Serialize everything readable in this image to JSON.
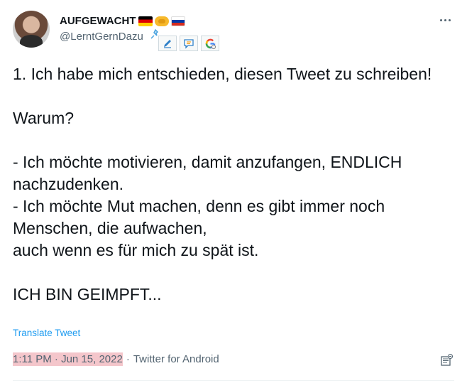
{
  "header": {
    "display_name": "AUFGEWACHT",
    "handle": "@LerntGernDazu"
  },
  "tweet": {
    "text": "1. Ich habe mich entschieden, diesen Tweet zu schreiben!\n\nWarum?\n\n- Ich möchte motivieren, damit anzufangen, ENDLICH nachzudenken.\n- Ich möchte Mut machen, denn es gibt immer noch Menschen, die aufwachen,\nauch wenn es für mich zu spät ist.\n\nICH BIN GEIMPFT...",
    "translate_label": "Translate Tweet"
  },
  "meta": {
    "time": "1:11 PM · Jun 15, 2022",
    "separator": "·",
    "source": "Twitter for Android"
  },
  "icons": {
    "flags": [
      "flag-germany-icon",
      "handshake-icon",
      "flag-russia-icon"
    ],
    "extensions": [
      "pin-icon",
      "pencil-icon",
      "comment-icon",
      "google-icon"
    ],
    "more": "more-options-icon",
    "note": "note-icon"
  },
  "colors": {
    "link": "#1d9bf0",
    "secondary_text": "#536471",
    "highlight": "#f4c6cb"
  }
}
